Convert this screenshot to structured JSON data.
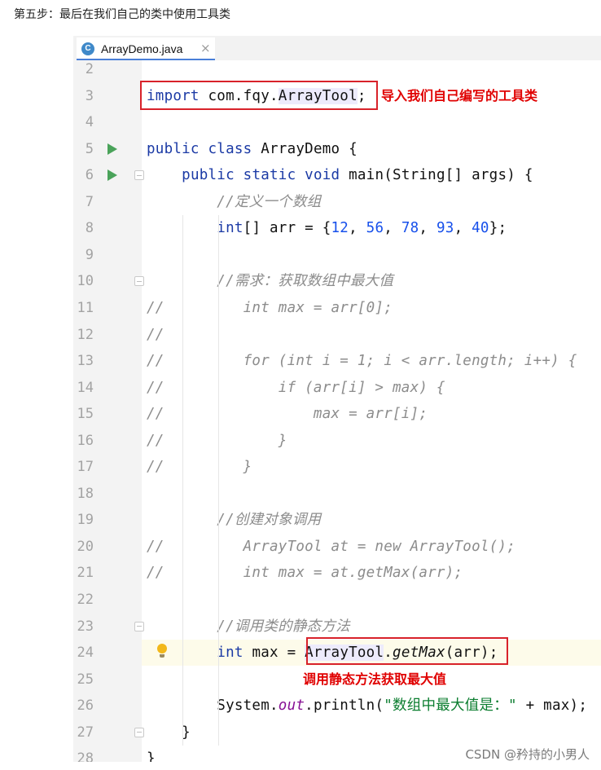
{
  "heading": "第五步：最后在我们自己的类中使用工具类",
  "tab": {
    "label": "ArrayDemo.java",
    "icon_letter": "C",
    "close": "×"
  },
  "lines": [
    {
      "n": "2"
    },
    {
      "n": "3",
      "tokens": [
        [
          "kw",
          "import"
        ],
        [
          "",
          " com.fqy."
        ],
        [
          "hl",
          "ArrayTool"
        ],
        [
          "",
          ";"
        ]
      ]
    },
    {
      "n": "4"
    },
    {
      "n": "5",
      "run": true,
      "tokens": [
        [
          "kw",
          "public class"
        ],
        [
          "",
          " ArrayDemo {"
        ]
      ]
    },
    {
      "n": "6",
      "run": true,
      "fold": "open",
      "tokens": [
        [
          "",
          "    "
        ],
        [
          "kw",
          "public static void"
        ],
        [
          "",
          " main(String[] args) {"
        ]
      ]
    },
    {
      "n": "7",
      "tokens": [
        [
          "",
          "        "
        ],
        [
          "cmt",
          "//定义一个数组"
        ]
      ]
    },
    {
      "n": "8",
      "tokens": [
        [
          "",
          "        "
        ],
        [
          "kw",
          "int"
        ],
        [
          "",
          "[] arr = {"
        ],
        [
          "num",
          "12"
        ],
        [
          "",
          ", "
        ],
        [
          "num",
          "56"
        ],
        [
          "",
          ", "
        ],
        [
          "num",
          "78"
        ],
        [
          "",
          ", "
        ],
        [
          "num",
          "93"
        ],
        [
          "",
          ", "
        ],
        [
          "num",
          "40"
        ],
        [
          "",
          "};"
        ]
      ]
    },
    {
      "n": "9"
    },
    {
      "n": "10",
      "fold": "open",
      "tokens": [
        [
          "",
          "        "
        ],
        [
          "cmt",
          "//需求：获取数组中最大值"
        ]
      ]
    },
    {
      "n": "11",
      "tokens": [
        [
          "cmt",
          "//         int max = arr[0];"
        ]
      ]
    },
    {
      "n": "12",
      "tokens": [
        [
          "cmt",
          "//"
        ]
      ]
    },
    {
      "n": "13",
      "tokens": [
        [
          "cmt",
          "//         for (int i = 1; i < arr.length; i++) {"
        ]
      ]
    },
    {
      "n": "14",
      "tokens": [
        [
          "cmt",
          "//             if (arr[i] > max) {"
        ]
      ]
    },
    {
      "n": "15",
      "tokens": [
        [
          "cmt",
          "//                 max = arr[i];"
        ]
      ]
    },
    {
      "n": "16",
      "tokens": [
        [
          "cmt",
          "//             }"
        ]
      ]
    },
    {
      "n": "17",
      "tokens": [
        [
          "cmt",
          "//         }"
        ]
      ]
    },
    {
      "n": "18"
    },
    {
      "n": "19",
      "tokens": [
        [
          "",
          "        "
        ],
        [
          "cmt",
          "//创建对象调用"
        ]
      ]
    },
    {
      "n": "20",
      "tokens": [
        [
          "cmt",
          "//         ArrayTool at = new ArrayTool();"
        ]
      ]
    },
    {
      "n": "21",
      "tokens": [
        [
          "cmt",
          "//         int max = at.getMax(arr);"
        ]
      ]
    },
    {
      "n": "22"
    },
    {
      "n": "23",
      "fold": "close",
      "tokens": [
        [
          "",
          "        "
        ],
        [
          "cmt",
          "//调用类的静态方法"
        ]
      ]
    },
    {
      "n": "24",
      "current": true,
      "bulb": true,
      "tokens": [
        [
          "",
          "        "
        ],
        [
          "kw",
          "int"
        ],
        [
          "",
          " max = "
        ],
        [
          "hl",
          "ArrayTool"
        ],
        [
          "",
          "."
        ],
        [
          "it",
          "getMax"
        ],
        [
          "",
          "(arr);"
        ]
      ]
    },
    {
      "n": "25"
    },
    {
      "n": "26",
      "tokens": [
        [
          "",
          "        System."
        ],
        [
          "stat",
          "out"
        ],
        [
          "",
          ".println("
        ],
        [
          "str",
          "\"数组中最大值是：\""
        ],
        [
          "",
          " + max);"
        ]
      ]
    },
    {
      "n": "27",
      "fold": "close",
      "tokens": [
        [
          "",
          "    }"
        ]
      ]
    },
    {
      "n": "28",
      "tokens": [
        [
          "",
          "}"
        ]
      ]
    }
  ],
  "annotations": {
    "import_note": "导入我们自己编写的工具类",
    "static_note": "调用静态方法获取最大值"
  },
  "watermark": "CSDN @矜持的小男人",
  "colors": {
    "annotation_red": "#d8222a",
    "run_green": "#4aa35a",
    "keyword_blue": "#1b3aa5"
  }
}
